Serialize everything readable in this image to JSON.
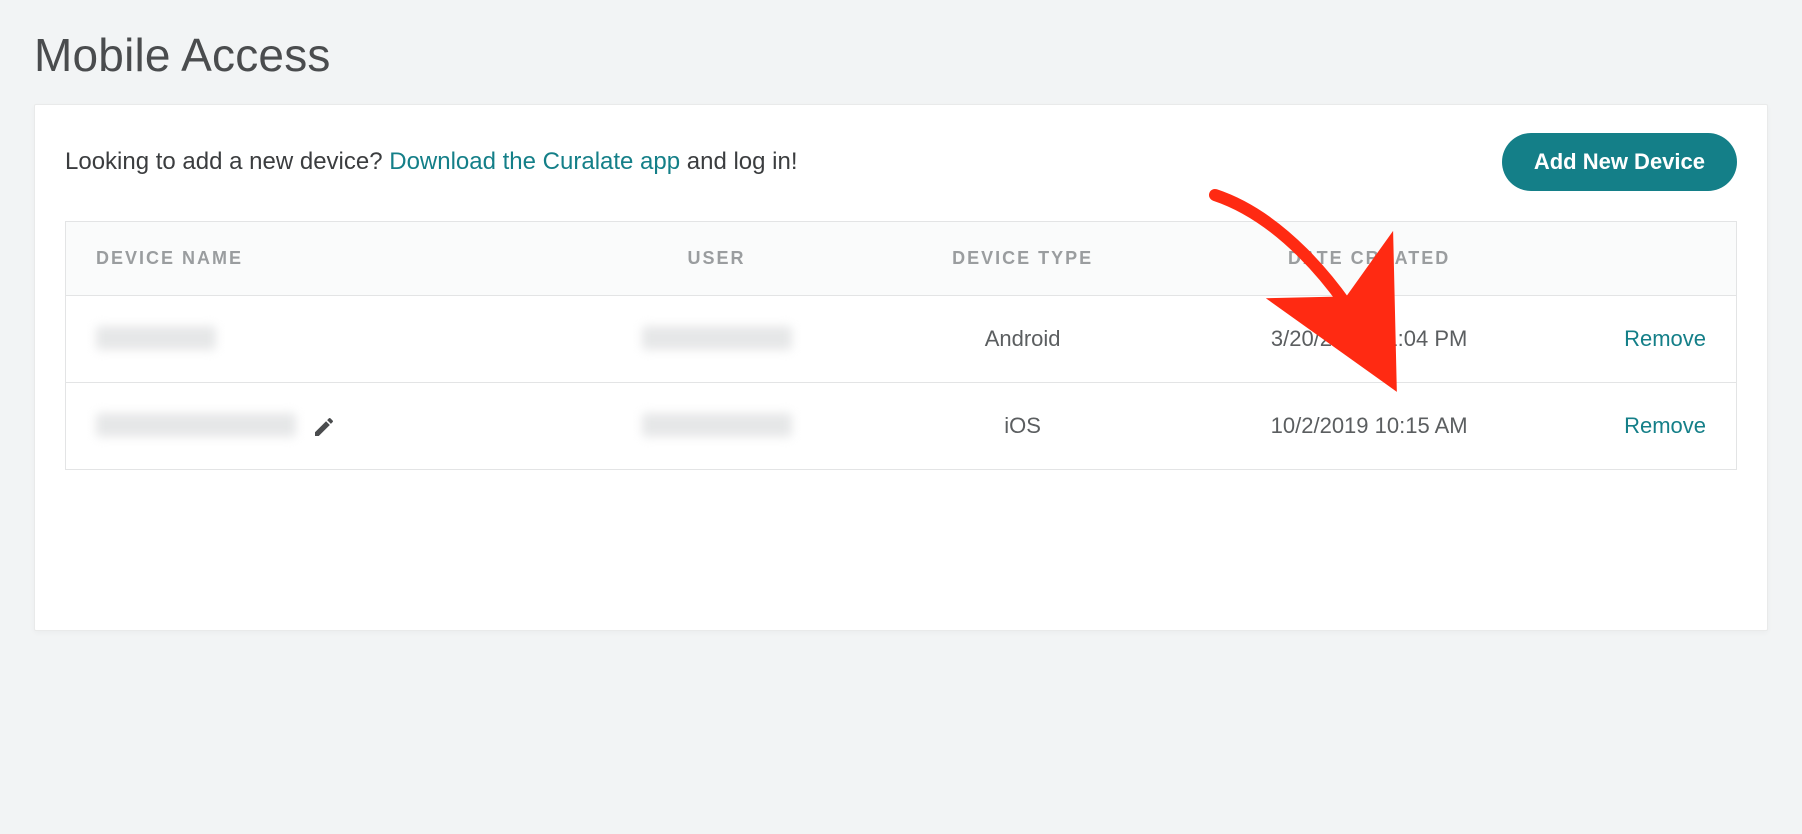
{
  "page": {
    "title": "Mobile Access",
    "prompt_prefix": "Looking to add a new device? ",
    "prompt_link": "Download the Curalate app",
    "prompt_suffix": " and log in!",
    "add_button": "Add New Device"
  },
  "table": {
    "headers": {
      "device_name": "DEVICE NAME",
      "user": "USER",
      "device_type": "DEVICE TYPE",
      "date_created": "DATE CREATED"
    },
    "rows": [
      {
        "device_name_redacted": true,
        "user_redacted": true,
        "device_type": "Android",
        "date_created": "3/20/2018 11:04 PM",
        "remove_label": "Remove",
        "show_edit": false
      },
      {
        "device_name_redacted": true,
        "user_redacted": true,
        "device_type": "iOS",
        "date_created": "10/2/2019 10:15 AM",
        "remove_label": "Remove",
        "show_edit": true
      }
    ]
  }
}
